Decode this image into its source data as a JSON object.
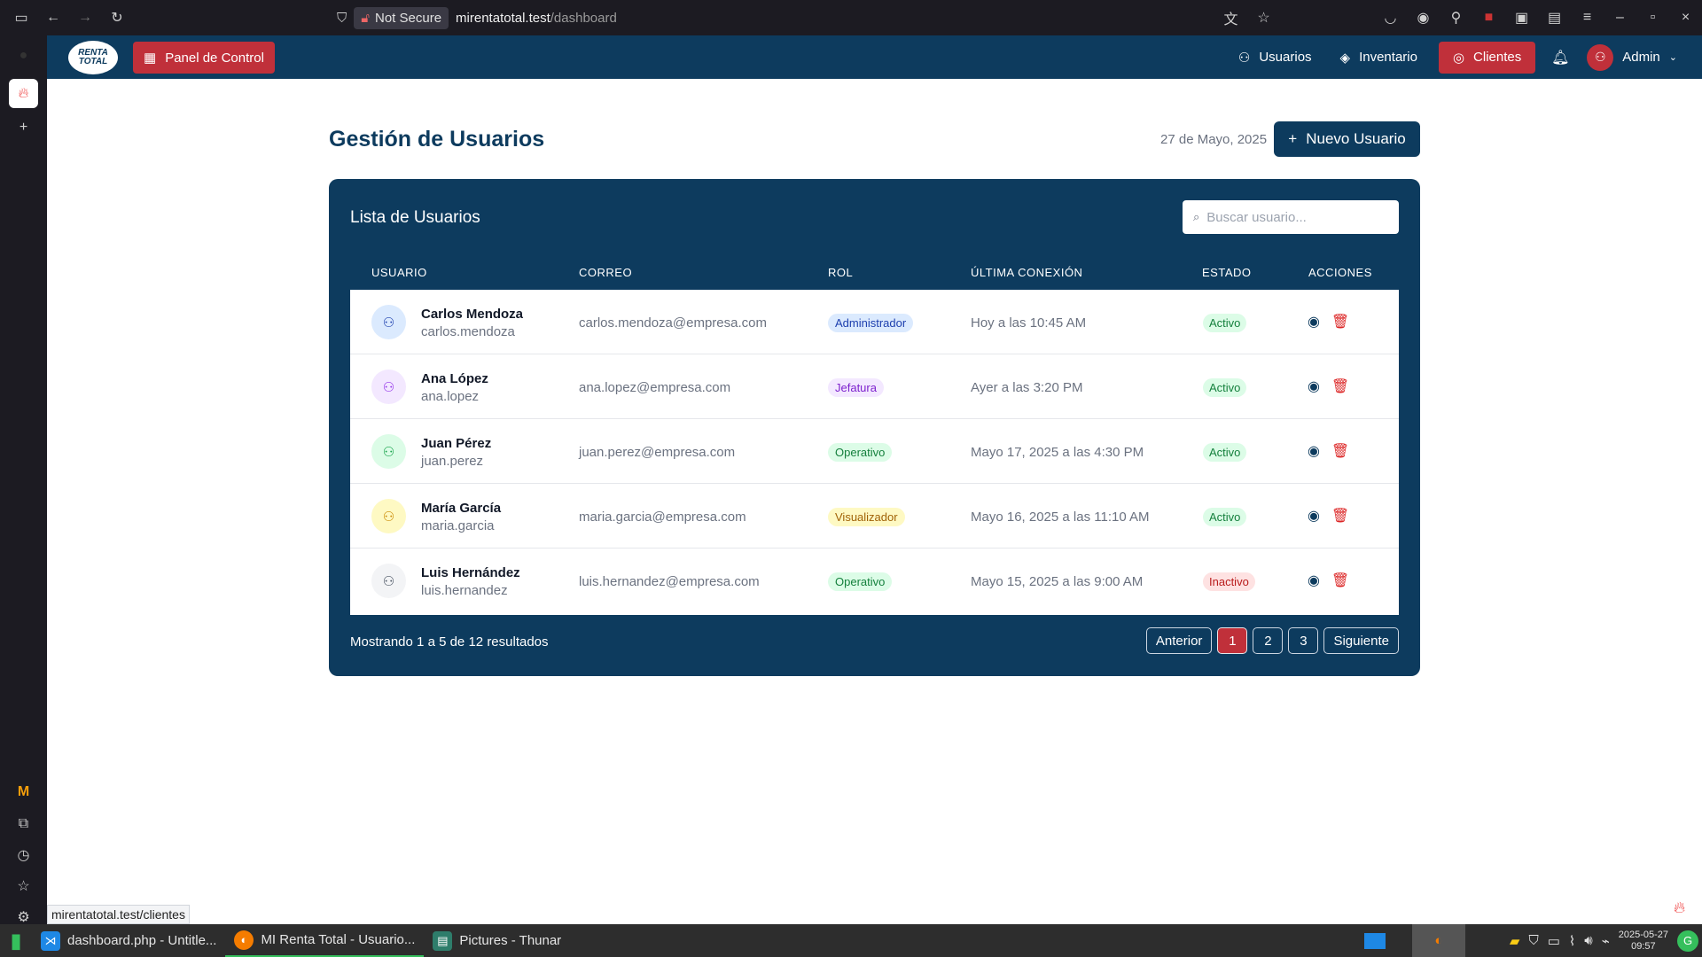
{
  "browser": {
    "not_secure": "Not Secure",
    "url_host": "mirentatotal.test",
    "url_path": "/dashboard"
  },
  "navbar": {
    "logo_line1": "RENTA",
    "logo_line2": "TOTAL",
    "panel_label": "Panel de Control",
    "links": [
      {
        "label": "Usuarios"
      },
      {
        "label": "Inventario"
      },
      {
        "label": "Clientes"
      }
    ],
    "admin_label": "Admin"
  },
  "page": {
    "title": "Gestión de Usuarios",
    "date": "27 de Mayo, 2025",
    "new_user_label": "Nuevo Usuario"
  },
  "list": {
    "title": "Lista de Usuarios",
    "search_placeholder": "Buscar usuario...",
    "columns": [
      "USUARIO",
      "CORREO",
      "ROL",
      "ÚLTIMA CONEXIÓN",
      "ESTADO",
      "ACCIONES"
    ],
    "rows": [
      {
        "name": "Carlos Mendoza",
        "login": "carlos.mendoza",
        "email": "carlos.mendoza@empresa.com",
        "role": "Administrador",
        "last": "Hoy a las 10:45 AM",
        "status": "Activo"
      },
      {
        "name": "Ana López",
        "login": "ana.lopez",
        "email": "ana.lopez@empresa.com",
        "role": "Jefatura",
        "last": "Ayer a las 3:20 PM",
        "status": "Activo"
      },
      {
        "name": "Juan Pérez",
        "login": "juan.perez",
        "email": "juan.perez@empresa.com",
        "role": "Operativo",
        "last": "Mayo 17, 2025 a las 4:30 PM",
        "status": "Activo"
      },
      {
        "name": "María García",
        "login": "maria.garcia",
        "email": "maria.garcia@empresa.com",
        "role": "Visualizador",
        "last": "Mayo 16, 2025 a las 11:10 AM",
        "status": "Activo"
      },
      {
        "name": "Luis Hernández",
        "login": "luis.hernandez",
        "email": "luis.hernandez@empresa.com",
        "role": "Operativo",
        "last": "Mayo 15, 2025 a las 9:00 AM",
        "status": "Inactivo"
      }
    ],
    "showing_prefix": "Mostrando",
    "showing_from": "1",
    "showing_a": "a",
    "showing_to": "5",
    "showing_de": "de",
    "showing_total": "12",
    "showing_suffix": "resultados",
    "pagination": {
      "prev": "Anterior",
      "pages": [
        "1",
        "2",
        "3"
      ],
      "next": "Siguiente",
      "current": "1"
    }
  },
  "status_tooltip": "mirentatotal.test/clientes",
  "taskbar": {
    "items": [
      {
        "label": "dashboard.php - Untitle..."
      },
      {
        "label": "MI Renta Total - Usuario..."
      },
      {
        "label": "Pictures - Thunar"
      }
    ],
    "clock_date": "2025-05-27",
    "clock_time": "09:57"
  },
  "colors": {
    "primary": "#0d3b5e",
    "accent": "#c0303a",
    "active_green": "#15803d",
    "inactive_red": "#b91c1c"
  }
}
